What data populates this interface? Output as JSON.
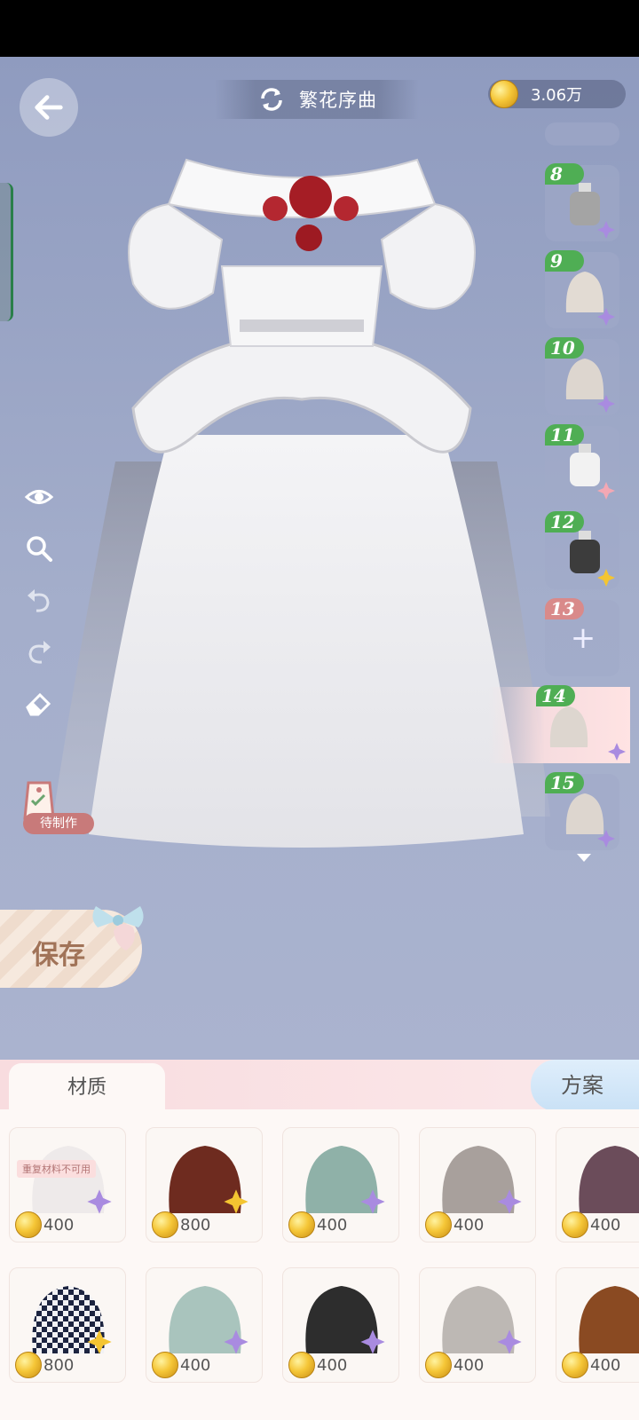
{
  "header": {
    "title": "繁花序曲",
    "currency": "3.06万"
  },
  "tools": [
    "eye-icon",
    "zoom-icon",
    "undo-icon",
    "redo-icon",
    "eraser-icon"
  ],
  "pending_tag": "待制作",
  "layers": [
    {
      "num": "8",
      "swatch": "#a4a4a4",
      "gem": "purple",
      "kind": "bottle"
    },
    {
      "num": "9",
      "swatch": "#e2dbd3",
      "gem": "purple",
      "kind": "cloth"
    },
    {
      "num": "10",
      "swatch": "#ddd6cf",
      "gem": "purple",
      "kind": "cloth"
    },
    {
      "num": "11",
      "swatch": "#f2f2f2",
      "gem": "pink",
      "kind": "bottle"
    },
    {
      "num": "12",
      "swatch": "#3c3c3c",
      "gem": "gold",
      "kind": "bottle"
    },
    {
      "num": "13",
      "swatch": "",
      "gem": "",
      "kind": "empty"
    },
    {
      "num": "14",
      "swatch": "#ddd6cf",
      "gem": "purple",
      "kind": "cloth"
    },
    {
      "num": "15",
      "swatch": "#ddd6cf",
      "gem": "purple",
      "kind": "cloth"
    }
  ],
  "save_label": "保存",
  "tabs": {
    "material": "材质",
    "scheme": "方案"
  },
  "materials": [
    {
      "color": "#eeeaea",
      "price": "400",
      "gem": "purple",
      "note": "重复材料不可用"
    },
    {
      "color": "#6e2b1f",
      "price": "800",
      "gem": "gold",
      "note": ""
    },
    {
      "color": "#8fb1a8",
      "price": "400",
      "gem": "purple",
      "note": ""
    },
    {
      "color": "#a8a09c",
      "price": "400",
      "gem": "purple",
      "note": ""
    },
    {
      "color": "#6b4c5a",
      "price": "400",
      "gem": "",
      "note": ""
    },
    {
      "color": "#1c2440",
      "price": "800",
      "gem": "gold",
      "note": ""
    },
    {
      "color": "#a9c4bd",
      "price": "400",
      "gem": "purple",
      "note": ""
    },
    {
      "color": "#2d2d2d",
      "price": "400",
      "gem": "purple",
      "note": ""
    },
    {
      "color": "#bdb8b4",
      "price": "400",
      "gem": "purple",
      "note": ""
    },
    {
      "color": "#8a4a22",
      "price": "400",
      "gem": "",
      "note": ""
    }
  ],
  "colors": {
    "gem_purple": "#a98be0",
    "gem_gold": "#f4c531",
    "gem_pink": "#f3a8b4"
  }
}
